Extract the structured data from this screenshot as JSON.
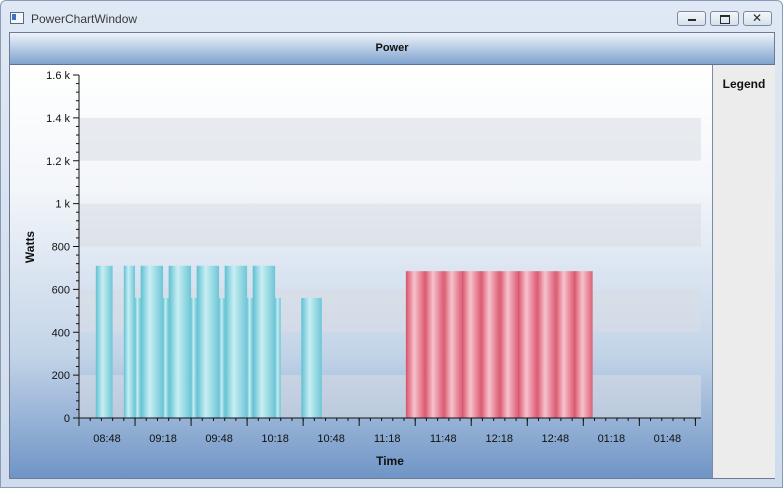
{
  "window": {
    "title": "PowerChartWindow"
  },
  "chart_title": "Power",
  "legend": {
    "title": "Legend"
  },
  "colors": {
    "blue_series": "#7fd0dd",
    "red_series": "#e56f83",
    "band": "#d9dde3"
  },
  "chart_data": {
    "type": "bar",
    "title": "Power",
    "xlabel": "Time",
    "ylabel": "Watts",
    "ylim": [
      0,
      1600
    ],
    "y_ticks": [
      0,
      200,
      400,
      600,
      800,
      1000,
      1200,
      1400,
      1600
    ],
    "y_tick_labels": [
      "0",
      "200",
      "400",
      "600",
      "800",
      "1 k",
      "1.2 k",
      "1.4 k",
      "1.6 k"
    ],
    "x_tick_labels": [
      "08:48",
      "09:18",
      "09:48",
      "10:18",
      "10:48",
      "11:18",
      "11:48",
      "12:18",
      "12:48",
      "01:18",
      "01:48"
    ],
    "x_tick_minutes": [
      528,
      558,
      588,
      618,
      648,
      678,
      708,
      738,
      768,
      798,
      828
    ],
    "xlim_minutes": [
      513,
      846
    ],
    "series": [
      {
        "color": "blue",
        "bars": [
          {
            "start": 522,
            "end": 531,
            "value": 710
          },
          {
            "start": 537,
            "end": 543,
            "value": 710
          },
          {
            "start": 543,
            "end": 546,
            "value": 560
          },
          {
            "start": 546,
            "end": 558,
            "value": 710
          },
          {
            "start": 558,
            "end": 561,
            "value": 560
          },
          {
            "start": 561,
            "end": 573,
            "value": 710
          },
          {
            "start": 573,
            "end": 576,
            "value": 560
          },
          {
            "start": 576,
            "end": 588,
            "value": 710
          },
          {
            "start": 588,
            "end": 591,
            "value": 560
          },
          {
            "start": 591,
            "end": 603,
            "value": 710
          },
          {
            "start": 603,
            "end": 606,
            "value": 560
          },
          {
            "start": 606,
            "end": 618,
            "value": 710
          },
          {
            "start": 618,
            "end": 621,
            "value": 560
          },
          {
            "start": 632,
            "end": 643,
            "value": 560
          }
        ]
      },
      {
        "color": "red",
        "bars": [
          {
            "start": 688,
            "end": 698,
            "value": 685
          },
          {
            "start": 698,
            "end": 708,
            "value": 685
          },
          {
            "start": 708,
            "end": 718,
            "value": 685
          },
          {
            "start": 718,
            "end": 728,
            "value": 685
          },
          {
            "start": 728,
            "end": 738,
            "value": 685
          },
          {
            "start": 738,
            "end": 748,
            "value": 685
          },
          {
            "start": 748,
            "end": 758,
            "value": 685
          },
          {
            "start": 758,
            "end": 768,
            "value": 685
          },
          {
            "start": 768,
            "end": 778,
            "value": 685
          },
          {
            "start": 778,
            "end": 788,
            "value": 685
          }
        ]
      }
    ]
  }
}
